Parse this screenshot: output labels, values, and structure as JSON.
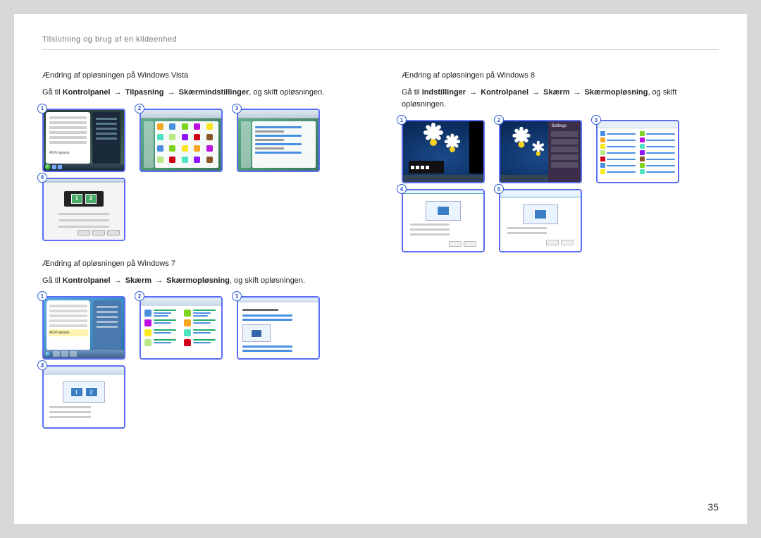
{
  "header": "Tilslutning og brug af en kildeenhed",
  "page_number": "35",
  "vista": {
    "title": "Ændring af opløsningen på Windows Vista",
    "desc_prefix": "Gå til ",
    "path": [
      "Kontrolpanel",
      "Tilpasning",
      "Skærmindstillinger"
    ],
    "desc_suffix": ", og skift opløsningen.",
    "badges": [
      "1",
      "2",
      "3",
      "4"
    ]
  },
  "win7": {
    "title": "Ændring af opløsningen på Windows 7",
    "desc_prefix": "Gå til ",
    "path": [
      "Kontrolpanel",
      "Skærm",
      "Skærmopløsning"
    ],
    "desc_suffix": ", og skift opløsningen.",
    "badges": [
      "1",
      "2",
      "3",
      "4"
    ]
  },
  "win8": {
    "title": "Ændring af opløsningen på Windows 8",
    "desc_prefix": "Gå til ",
    "path": [
      "Indstillinger",
      "Kontrolpanel",
      "Skærm",
      "Skærmopløsning"
    ],
    "desc_suffix": ", og skift opløsningen.",
    "badges": [
      "1",
      "2",
      "3",
      "4",
      "5"
    ]
  },
  "arrow": "→"
}
